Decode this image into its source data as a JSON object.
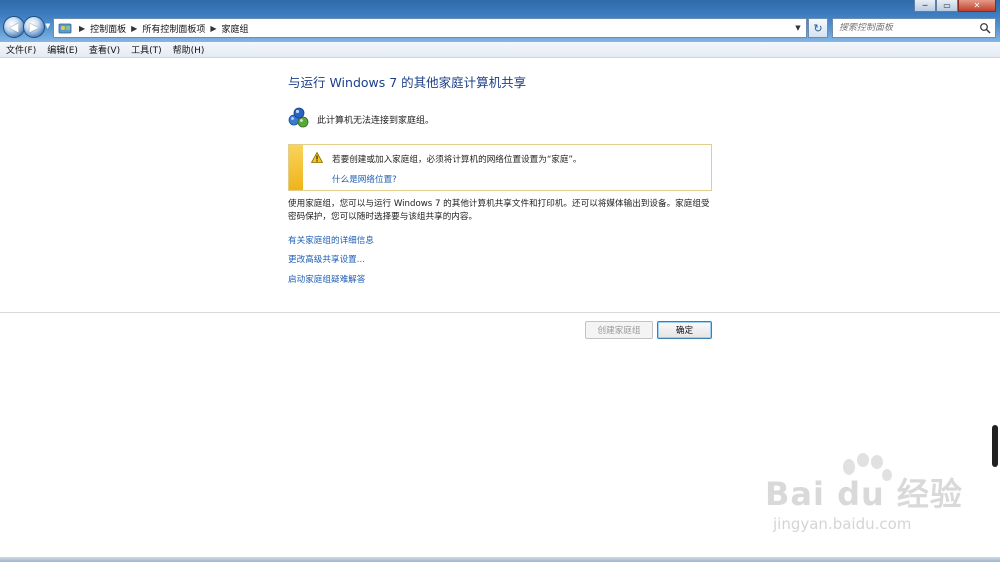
{
  "window": {
    "min_label": "─",
    "max_label": "▭",
    "close_label": "✕"
  },
  "address": {
    "crumbs": [
      "控制面板",
      "所有控制面板项",
      "家庭组"
    ]
  },
  "search": {
    "placeholder": "搜索控制面板"
  },
  "menu": {
    "items": [
      "文件(F)",
      "编辑(E)",
      "查看(V)",
      "工具(T)",
      "帮助(H)"
    ]
  },
  "main": {
    "title": "与运行 Windows 7 的其他家庭计算机共享",
    "status": "此计算机无法连接到家庭组。",
    "warning_text": "若要创建或加入家庭组，必须将计算机的网络位置设置为“家庭”。",
    "warning_link": "什么是网络位置?",
    "description": "使用家庭组，您可以与运行 Windows 7 的其他计算机共享文件和打印机。还可以将媒体输出到设备。家庭组受密码保护，您可以随时选择要与该组共享的内容。",
    "links": [
      "有关家庭组的详细信息",
      "更改高级共享设置...",
      "启动家庭组疑难解答"
    ]
  },
  "buttons": {
    "create": "创建家庭组",
    "ok": "确定"
  },
  "watermark": {
    "logo": "Bai du 经验",
    "url": "jingyan.baidu.com"
  },
  "colors": {
    "title": "#1d3f8a",
    "link": "#1e5fb4",
    "warning_bar": "#f0b31a"
  }
}
